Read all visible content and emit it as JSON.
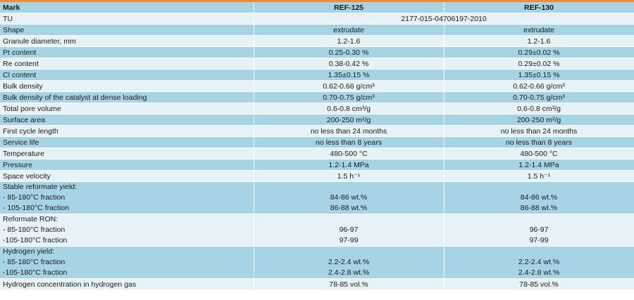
{
  "colors": {
    "top_border": "#f08a3c",
    "header_bg": "#a7d4e4",
    "row_light": "#e6f2f6",
    "row_dark": "#a7d4e4",
    "text": "#1a1a1a"
  },
  "header": {
    "mark": "Mark",
    "ref125": "REF-125",
    "ref130": "REF-130"
  },
  "tu": {
    "label": "TU",
    "value": "2177-015-04706197-2010"
  },
  "rows_a": [
    {
      "label": "Shape",
      "ref125": "extrudate",
      "ref130": "extrudate"
    },
    {
      "label": "Granule diameter, mm",
      "ref125": "1.2-1.6",
      "ref130": "1.2-1.6"
    },
    {
      "label": "Pt content",
      "ref125": "0.25-0.30 %",
      "ref130": "0.29±0.02 %"
    },
    {
      "label": "Re content",
      "ref125": "0.38-0.42 %",
      "ref130": "0.29±0.02 %"
    },
    {
      "label": "Cl content",
      "ref125": "1.35±0.15 %",
      "ref130": "1.35±0.15 %"
    },
    {
      "label": "Bulk density",
      "ref125": "0.62-0.66 g/cm³",
      "ref130": "0.62-0.66 g/cm³"
    },
    {
      "label": "Bulk density of the catalyst  at dense loading",
      "ref125": "0.70-0.75 g/cm³",
      "ref130": "0.70-0.75 g/cm³"
    },
    {
      "label": "Total pore volume",
      "ref125": "0.6-0.8 cm³/g",
      "ref130": "0.6-0.8 cm³/g"
    },
    {
      "label": "Surface area",
      "ref125": "200-250 m²/g",
      "ref130": "200-250 m²/g"
    },
    {
      "label": "First cycle length",
      "ref125": "no less than 24 months",
      "ref130": "no less than 24 months"
    },
    {
      "label": "Service life",
      "ref125": "no less than 8 years",
      "ref130": "no less than 8 years"
    },
    {
      "label": "Temperature",
      "ref125": "480-500 °C",
      "ref130": "480-500 °C"
    },
    {
      "label": "Pressure",
      "ref125": "1.2-1.4 MPa",
      "ref130": "1.2-1.4 MPa"
    },
    {
      "label": "Space velocity",
      "ref125": "1.5 h⁻¹",
      "ref130": "1.5 h⁻¹"
    }
  ],
  "stable_yield": {
    "title": "Stable reformate yield:",
    "line1": "- 85-180°C fraction",
    "line2": "- 105-180°C fraction",
    "ref125_1": "84-86 wt.%",
    "ref125_2": "86-88 wt.%",
    "ref130_1": "84-86 wt.%",
    "ref130_2": "86-88 wt.%"
  },
  "ron": {
    "title": "Reformate RON:",
    "line1": "- 85-180°C fraction",
    "line2": "-105-180°C fraction",
    "ref125_1": "96-97",
    "ref125_2": "97-99",
    "ref130_1": "96-97",
    "ref130_2": "97-99"
  },
  "hydrogen_yield": {
    "title": "Hydrogen yield:",
    "line1": "- 85-180°C fraction",
    "line2": "-105-180°C fraction",
    "ref125_1": "2.2-2.4 wt.%",
    "ref125_2": "2.4-2.8 wt.%",
    "ref130_1": "2.2-2.4 wt.%",
    "ref130_2": "2.4-2.8 wt.%"
  },
  "h2_concentration": {
    "label": "Hydrogen concentration in hydrogen gas",
    "ref125": "78-85 vol.%",
    "ref130": "78-85 vol.%"
  }
}
